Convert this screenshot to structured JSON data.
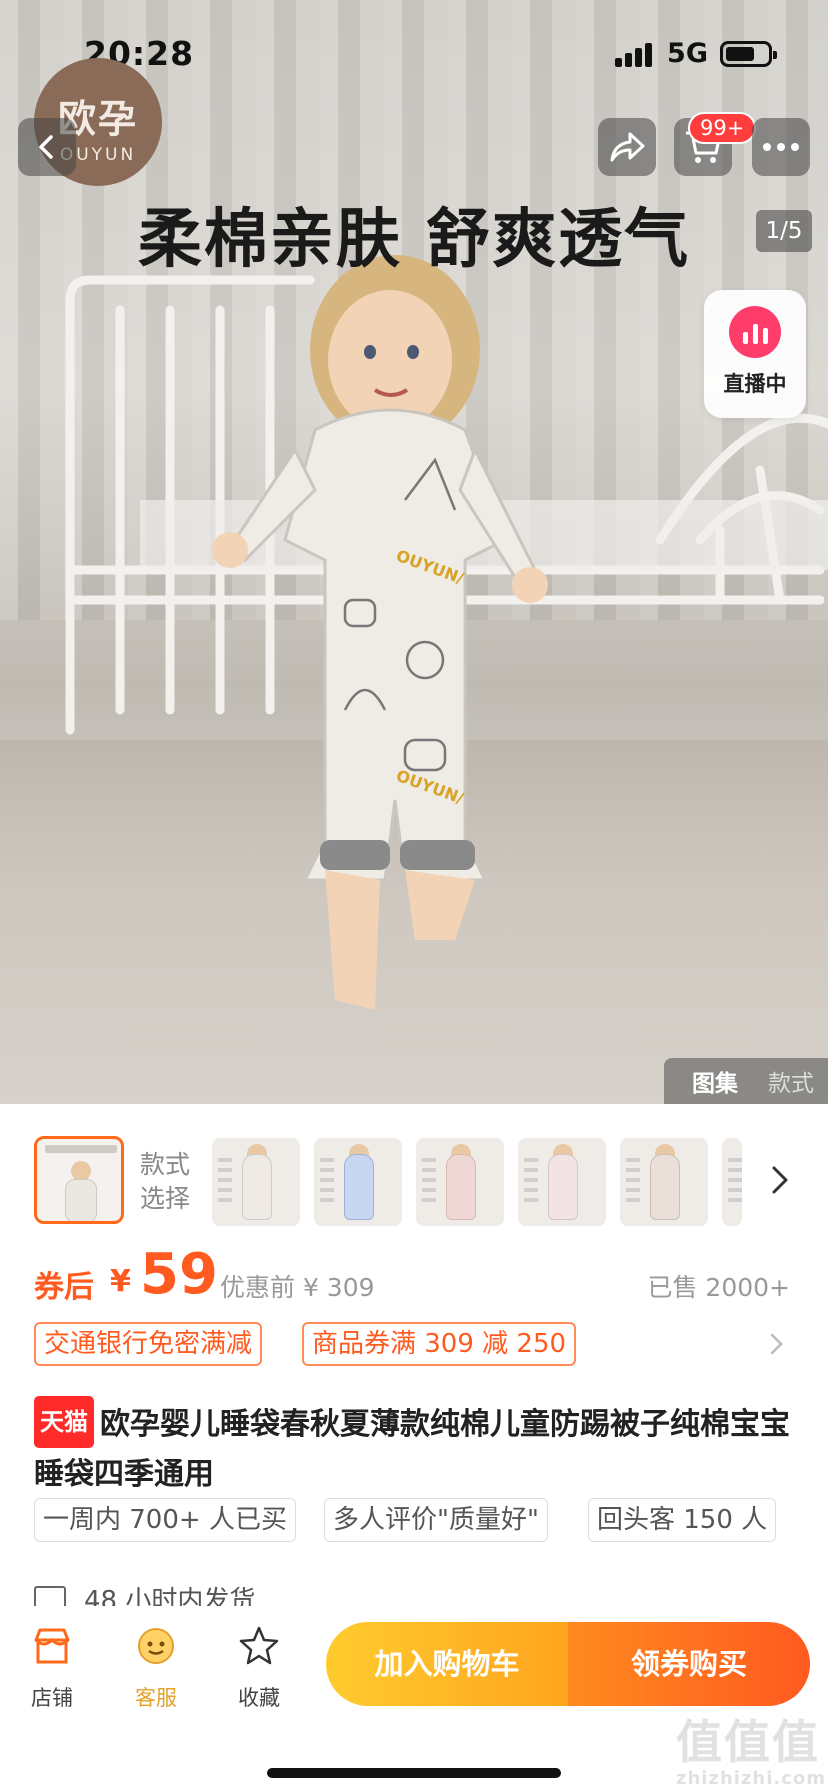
{
  "status_bar": {
    "time": "20:28",
    "network": "5G"
  },
  "brand_logo": {
    "cn": "欧孕",
    "en": "OUYUN"
  },
  "header": {
    "cart_badge": "99+"
  },
  "hero": {
    "headline": "柔棉亲肤 舒爽透气",
    "image_counter": "1/5",
    "live_label": "直播中",
    "gallery_tabs": [
      "图集",
      "款式"
    ]
  },
  "variants": {
    "label": "款式\n选择",
    "thumbnail_count": 6
  },
  "price": {
    "after_label": "券后",
    "currency": "¥",
    "value": "59",
    "before_label": "优惠前 ¥ 309",
    "sold": "已售 2000+"
  },
  "coupons": [
    "交通银行免密满减",
    "商品券满 309 减 250"
  ],
  "product": {
    "store_badge": "天猫",
    "title": "欧孕婴儿睡袋春秋夏薄款纯棉儿童防踢被子纯棉宝宝睡袋四季通用"
  },
  "tags": [
    "一周内 700+ 人已买",
    "多人评价\"质量好\"",
    "回头客 150 人"
  ],
  "shipping": "48 小时内发货",
  "bottom_bar": {
    "shop": "店铺",
    "service": "客服",
    "favorite": "收藏",
    "add_cart": "加入购物车",
    "buy": "领券购买"
  },
  "watermark": {
    "text": "值值值",
    "domain": "zhizhizhi.com"
  },
  "colors": {
    "accent": "#ff5a1f",
    "cart_button": "#ffb31e",
    "tmall": "#ff2a2a",
    "live": "#ff3d6a"
  }
}
